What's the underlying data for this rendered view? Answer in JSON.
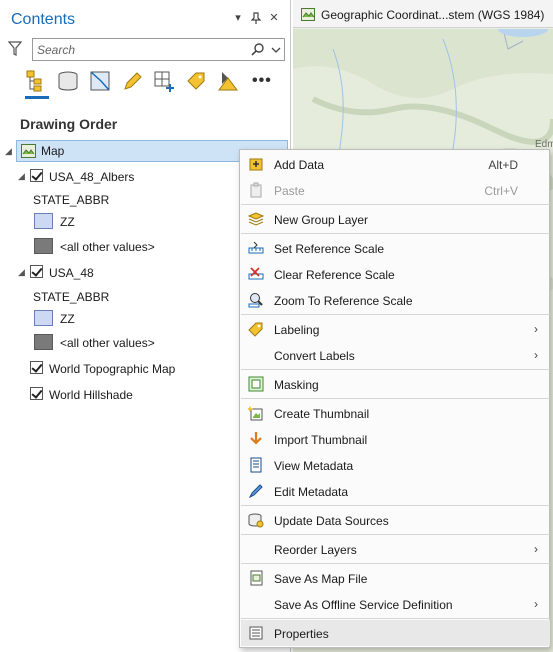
{
  "contents": {
    "title": "Contents",
    "search_placeholder": "Search",
    "section_title": "Drawing Order",
    "map_label": "Map",
    "layers": [
      {
        "name": "USA_48_Albers",
        "field": "STATE_ABBR",
        "classes": [
          "ZZ",
          "<all other values>"
        ]
      },
      {
        "name": "USA_48",
        "field": "STATE_ABBR",
        "classes": [
          "ZZ",
          "<all other values>"
        ]
      }
    ],
    "basemaps": [
      "World Topographic Map",
      "World Hillshade"
    ],
    "header_buttons": {
      "dropdown": "▾",
      "pin": "✢",
      "close": "✕"
    }
  },
  "mapview": {
    "tab_title": "Geographic Coordinat...stem (WGS 1984)",
    "label_edm": "Edm"
  },
  "menu": {
    "items": [
      {
        "label": "Add Data",
        "shortcut": "Alt+D",
        "icon": "add-data-icon"
      },
      {
        "label": "Paste",
        "shortcut": "Ctrl+V",
        "icon": "paste-icon",
        "disabled": true
      },
      {
        "label": "New Group Layer",
        "icon": "group-layer-icon"
      },
      {
        "label": "Set Reference Scale",
        "icon": "reference-scale-icon"
      },
      {
        "label": "Clear Reference Scale",
        "icon": "clear-scale-icon"
      },
      {
        "label": "Zoom To Reference Scale",
        "icon": "zoom-scale-icon"
      },
      {
        "label": "Labeling",
        "icon": "labeling-icon",
        "submenu": true
      },
      {
        "label": "Convert Labels",
        "submenu": true
      },
      {
        "label": "Masking",
        "icon": "masking-icon"
      },
      {
        "label": "Create Thumbnail",
        "icon": "create-thumbnail-icon"
      },
      {
        "label": "Import Thumbnail",
        "icon": "import-thumbnail-icon"
      },
      {
        "label": "View Metadata",
        "icon": "view-metadata-icon"
      },
      {
        "label": "Edit Metadata",
        "icon": "edit-metadata-icon"
      },
      {
        "label": "Update Data Sources",
        "icon": "update-sources-icon"
      },
      {
        "label": "Reorder Layers",
        "submenu": true
      },
      {
        "label": "Save As Map File",
        "icon": "save-map-file-icon"
      },
      {
        "label": "Save As Offline Service Definition",
        "submenu": true
      },
      {
        "label": "Properties",
        "icon": "properties-icon"
      }
    ]
  },
  "colors": {
    "accent": "#1a6bb8",
    "selection": "#cfe3f7",
    "swatch_zz": "#cdd8f2",
    "swatch_other": "#7a7a7a"
  }
}
